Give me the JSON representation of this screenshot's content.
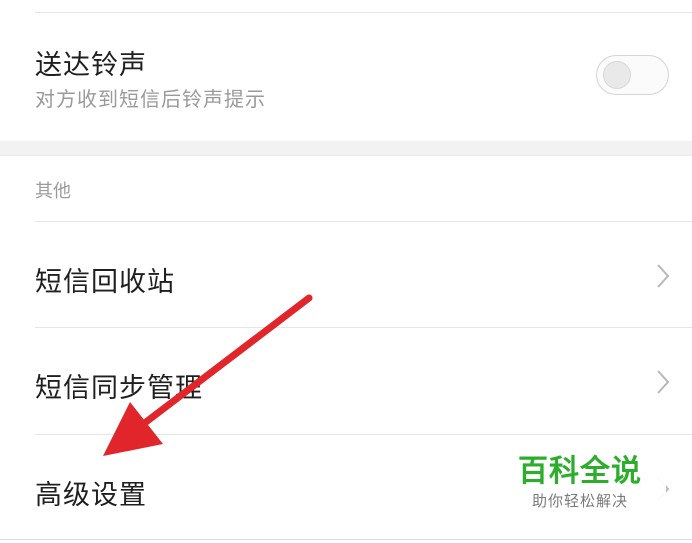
{
  "settings": {
    "delivery_ringtone": {
      "title": "送达铃声",
      "subtitle": "对方收到短信后铃声提示",
      "toggle_on": false
    },
    "section_other_label": "其他",
    "items": [
      {
        "label": "短信回收站",
        "icon": "chevron-right-icon"
      },
      {
        "label": "短信同步管理",
        "icon": "chevron-right-icon"
      },
      {
        "label": "高级设置",
        "icon": "chevron-right-icon"
      }
    ]
  },
  "watermark": {
    "title": "百科全说",
    "subtitle": "助你轻松解决",
    "color": "#2cae2c"
  },
  "annotation": {
    "type": "arrow",
    "color": "#e0262b",
    "points_to": "高级设置"
  }
}
